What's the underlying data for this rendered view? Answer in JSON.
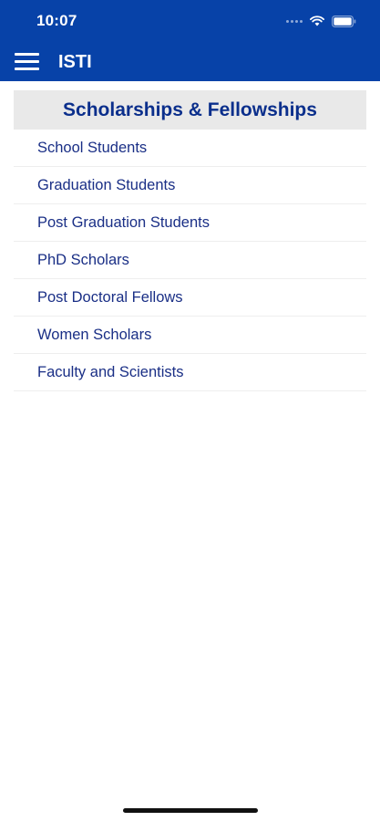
{
  "status_bar": {
    "time": "10:07",
    "icons": [
      "cellular-signal-icon",
      "wifi-icon",
      "battery-icon"
    ]
  },
  "app_bar": {
    "title": "ISTI",
    "menu_icon": "hamburger-menu-icon"
  },
  "section": {
    "header": "Scholarships & Fellowships",
    "items": [
      {
        "label": "School Students"
      },
      {
        "label": "Graduation Students"
      },
      {
        "label": "Post Graduation Students"
      },
      {
        "label": "PhD Scholars"
      },
      {
        "label": "Post Doctoral Fellows"
      },
      {
        "label": "Women Scholars"
      },
      {
        "label": "Faculty and Scientists"
      }
    ]
  },
  "colors": {
    "primary": "#0742a8",
    "header_text": "#0b2f8c",
    "item_text": "#1a2f86",
    "header_background": "#e9e9e9"
  }
}
